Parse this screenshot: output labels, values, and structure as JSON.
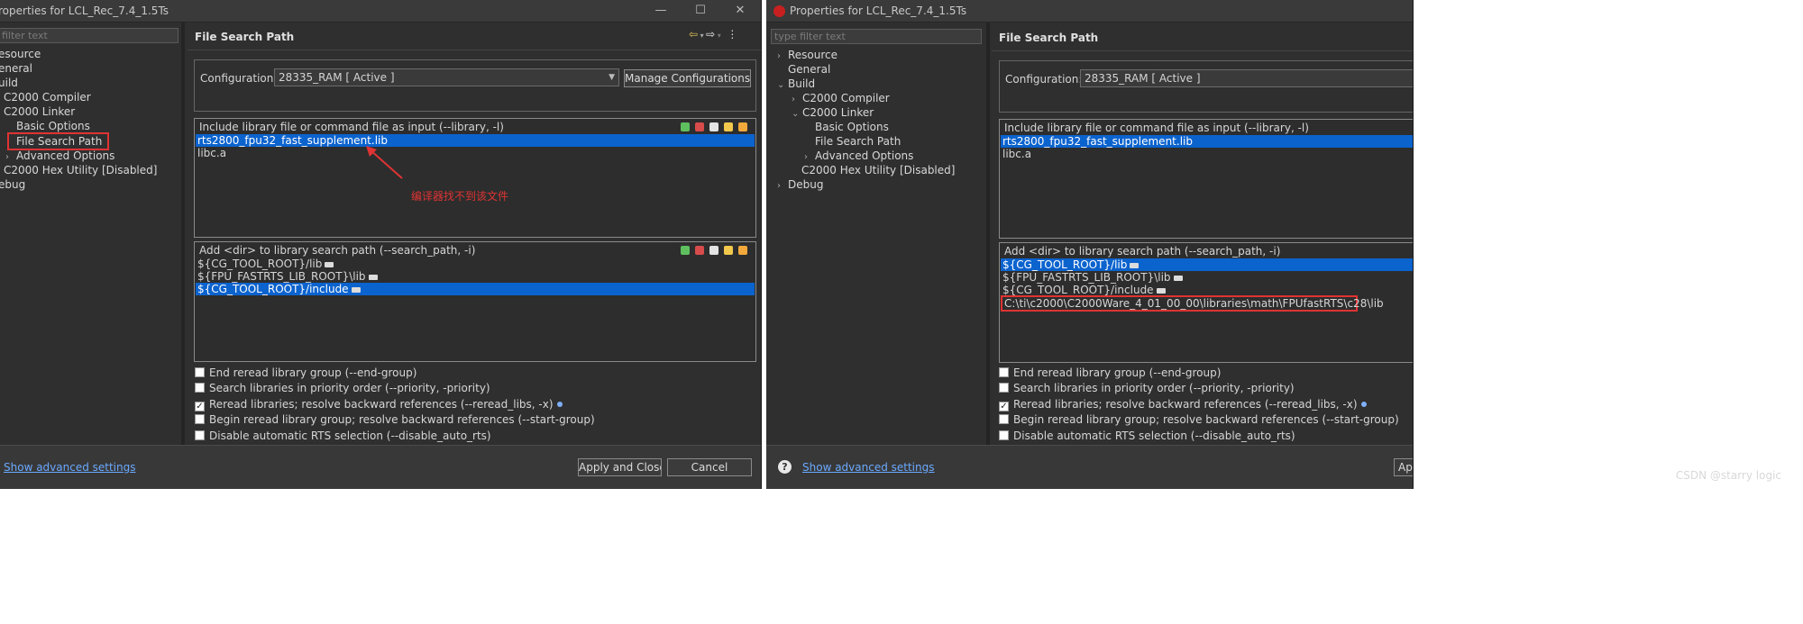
{
  "left": {
    "title": "roperties for LCL_Rec_7.4_1.5Ts",
    "filter_placeholder": "filter text",
    "tree": [
      "esource",
      "eneral",
      "uild",
      "C2000 Compiler",
      "C2000 Linker",
      "Basic Options",
      "File Search Path",
      "Advanced Options",
      "C2000 Hex Utility  [Disabled]",
      "ebug"
    ],
    "panel_title": "File Search Path",
    "config_label": "Configuration:",
    "config_value": "28335_RAM  [ Active ]",
    "manage_button": "Manage Configurations...",
    "include_header": "Include library file or command file as input (--library, -l)",
    "include_rows": [
      "rts2800_fpu32_fast_supplement.lib",
      "libc.a"
    ],
    "search_header": "Add <dir> to library search path (--search_path, -i)",
    "search_rows": [
      "${CG_TOOL_ROOT}/lib",
      "${FPU_FASTRTS_LIB_ROOT}\\lib",
      "${CG_TOOL_ROOT}/include"
    ],
    "checkboxes": [
      {
        "label": "End reread library group (--end-group)",
        "checked": false
      },
      {
        "label": "Search libraries in priority order (--priority, -priority)",
        "checked": false
      },
      {
        "label": "Reread libraries; resolve backward references (--reread_libs, -x)",
        "checked": true
      },
      {
        "label": "Begin reread library group; resolve backward references (--start-group)",
        "checked": false
      },
      {
        "label": "Disable automatic RTS selection (--disable_auto_rts)",
        "checked": false
      }
    ],
    "advanced_link": "Show advanced settings",
    "apply_button": "Apply and Close",
    "cancel_button": "Cancel",
    "annotation": "编译器找不到该文件"
  },
  "right": {
    "title": "Properties for LCL_Rec_7.4_1.5Ts",
    "filter_placeholder": "type filter text",
    "tree": [
      "Resource",
      "General",
      "Build",
      "C2000 Compiler",
      "C2000 Linker",
      "Basic Options",
      "File Search Path",
      "Advanced Options",
      "C2000 Hex Utility  [Disabled]",
      "Debug"
    ],
    "panel_title": "File Search Path",
    "config_label": "Configuration:",
    "config_value": "28335_RAM  [ Active ]",
    "include_header": "Include library file or command file as input (--library, -l)",
    "include_rows": [
      "rts2800_fpu32_fast_supplement.lib",
      "libc.a"
    ],
    "search_header": "Add <dir> to library search path (--search_path, -i)",
    "search_rows": [
      "${CG_TOOL_ROOT}/lib",
      "${FPU_FASTRTS_LIB_ROOT}\\lib",
      "${CG_TOOL_ROOT}/include",
      "C:\\ti\\c2000\\C2000Ware_4_01_00_00\\libraries\\math\\FPUfastRTS\\c28\\lib"
    ],
    "checkboxes": [
      {
        "label": "End reread library group (--end-group)",
        "checked": false
      },
      {
        "label": "Search libraries in priority order (--priority, -priority)",
        "checked": false
      },
      {
        "label": "Reread libraries; resolve backward references (--reread_libs, -x)",
        "checked": true
      },
      {
        "label": "Begin reread library group; resolve backward references (--start-group)",
        "checked": false
      },
      {
        "label": "Disable automatic RTS selection (--disable_auto_rts)",
        "checked": false
      }
    ],
    "advanced_link": "Show advanced settings",
    "apply_button_partial": "Ap"
  },
  "watermark": "CSDN @starry logic",
  "colors": {
    "selection": "#0b63ce",
    "highlight": "#e03333",
    "link": "#6aa9ff"
  }
}
